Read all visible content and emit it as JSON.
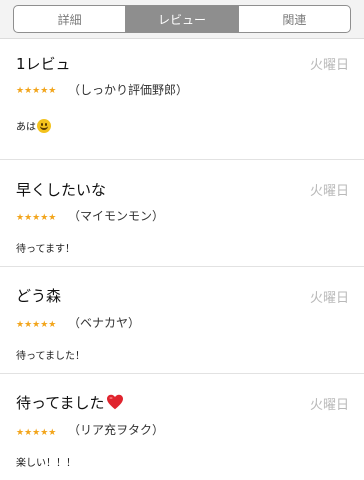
{
  "tabs": [
    {
      "label": "詳細",
      "active": false
    },
    {
      "label": "レビュー",
      "active": true
    },
    {
      "label": "関連",
      "active": false
    }
  ],
  "reviews": [
    {
      "title": "1レビュ",
      "date": "火曜日",
      "rating": 5,
      "stars": "★★★★★",
      "author": "（しっかり評価野郎）",
      "body": "あは",
      "body_icon": "smile-emoji-icon"
    },
    {
      "title": "早くしたいな",
      "date": "火曜日",
      "rating": 5,
      "stars": "★★★★★",
      "author": "（マイモンモン）",
      "body": "待ってます！"
    },
    {
      "title": "どう森",
      "date": "火曜日",
      "rating": 5,
      "stars": "★★★★★",
      "author": "（ベナカヤ）",
      "body": "待ってました！"
    },
    {
      "title": "待ってました",
      "title_icon": "red-heart-icon",
      "date": "火曜日",
      "rating": 5,
      "stars": "★★★★★",
      "author": "（リア充ヲタク）",
      "body": "楽しい！！！"
    }
  ],
  "colors": {
    "star": "#f2a51c",
    "active_tab": "#8e8e8e",
    "date": "#b9b9b9",
    "heart": "#e0242e"
  }
}
